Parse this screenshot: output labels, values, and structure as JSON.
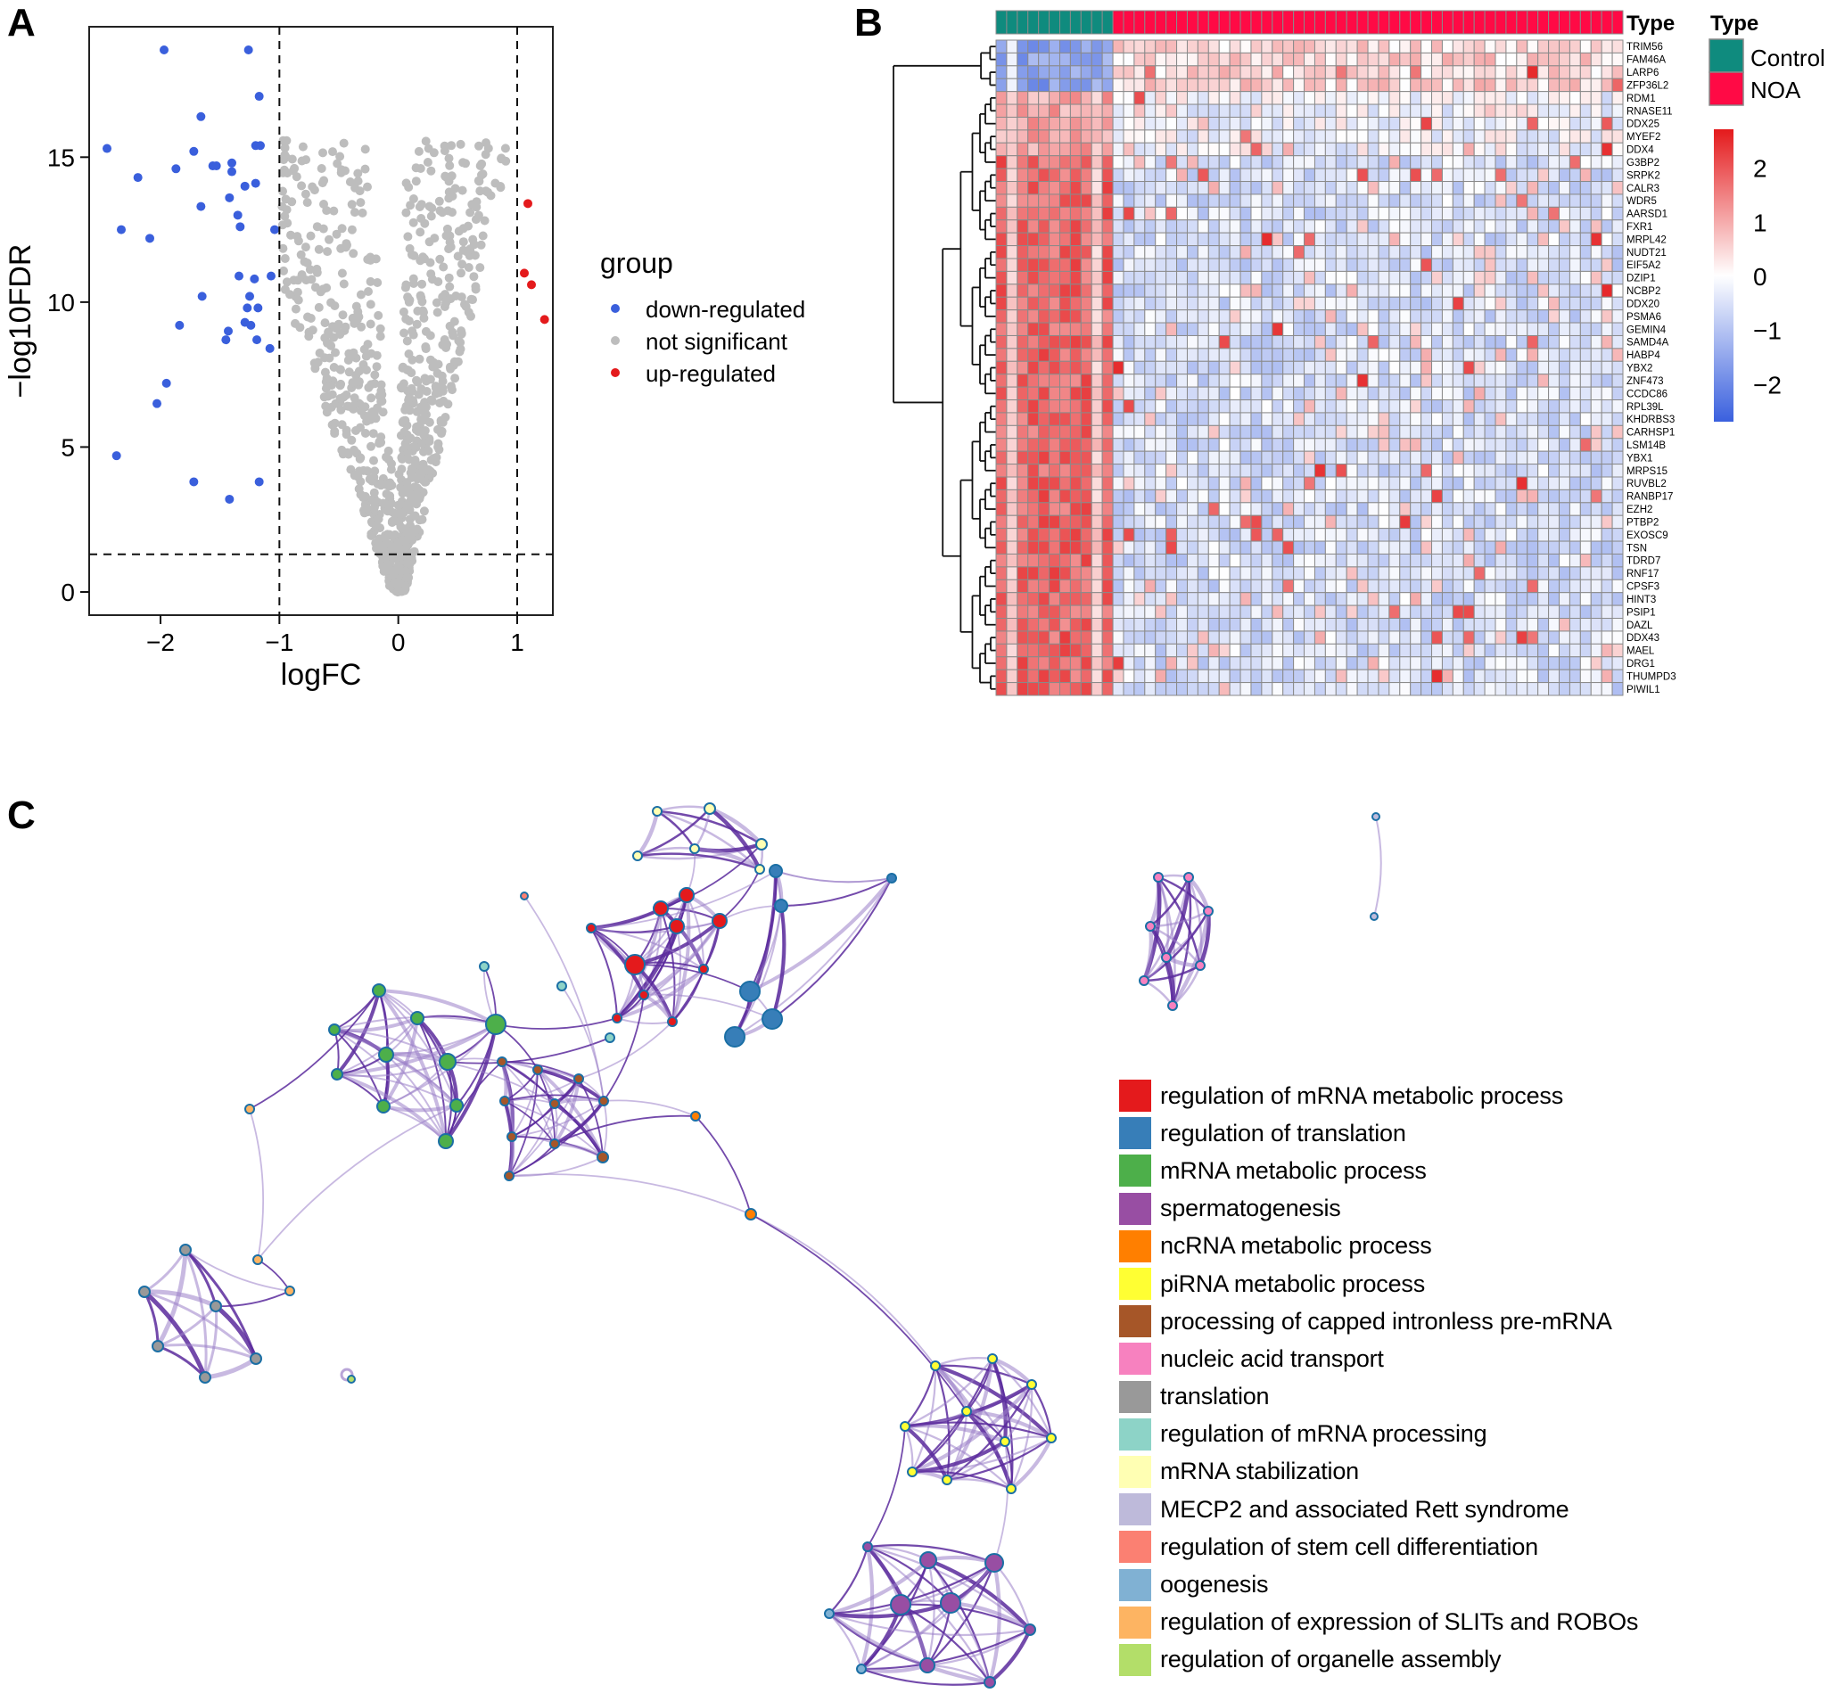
{
  "panels": {
    "a_label": "A",
    "b_label": "B",
    "c_label": "C"
  },
  "chart_data": [
    {
      "id": "volcano",
      "type": "scatter",
      "title": "",
      "xlabel": "logFC",
      "ylabel": "−log10FDR",
      "xlim": [
        -2.6,
        1.3
      ],
      "ylim": [
        -0.8,
        19.5
      ],
      "xticks": [
        -2,
        -1,
        0,
        1
      ],
      "xtick_labels": [
        "−2",
        "−1",
        "0",
        "1"
      ],
      "yticks": [
        0,
        5,
        10,
        15
      ],
      "ytick_labels": [
        "0",
        "5",
        "10",
        "15"
      ],
      "thresholds": {
        "logFC": [
          -1,
          1
        ],
        "neg_log10_FDR": 1.3
      },
      "grid": false,
      "legend": {
        "title": "group",
        "position": "right",
        "entries": [
          {
            "label": "down-regulated",
            "color": "#3A5FDC"
          },
          {
            "label": "not significant",
            "color": "#BDBDBD"
          },
          {
            "label": "up-regulated",
            "color": "#E41A1C"
          }
        ]
      },
      "series": [
        {
          "name": "down-regulated",
          "color": "#3A5FDC",
          "points": [
            [
              -1.97,
              18.7
            ],
            [
              -1.26,
              18.7
            ],
            [
              -1.17,
              17.1
            ],
            [
              -1.66,
              16.4
            ],
            [
              -2.45,
              15.3
            ],
            [
              -1.72,
              15.2
            ],
            [
              -1.2,
              15.4
            ],
            [
              -1.16,
              15.4
            ],
            [
              -1.56,
              14.7
            ],
            [
              -1.53,
              14.7
            ],
            [
              -1.4,
              14.8
            ],
            [
              -1.4,
              14.5
            ],
            [
              -1.87,
              14.6
            ],
            [
              -2.19,
              14.3
            ],
            [
              -1.29,
              14.0
            ],
            [
              -1.2,
              14.1
            ],
            [
              -1.42,
              13.6
            ],
            [
              -1.66,
              13.3
            ],
            [
              -1.35,
              13.0
            ],
            [
              -2.33,
              12.5
            ],
            [
              -2.09,
              12.2
            ],
            [
              -1.33,
              12.6
            ],
            [
              -1.04,
              12.5
            ],
            [
              -1.34,
              10.9
            ],
            [
              -1.21,
              10.8
            ],
            [
              -1.07,
              10.9
            ],
            [
              -1.65,
              10.2
            ],
            [
              -1.25,
              10.2
            ],
            [
              -1.27,
              9.8
            ],
            [
              -1.18,
              9.8
            ],
            [
              -1.84,
              9.2
            ],
            [
              -1.43,
              9.0
            ],
            [
              -1.29,
              9.3
            ],
            [
              -1.24,
              9.2
            ],
            [
              -1.45,
              8.7
            ],
            [
              -1.19,
              8.7
            ],
            [
              -1.08,
              8.4
            ],
            [
              -1.95,
              7.2
            ],
            [
              -2.03,
              6.5
            ],
            [
              -2.37,
              4.7
            ],
            [
              -1.72,
              3.8
            ],
            [
              -1.17,
              3.8
            ],
            [
              -1.42,
              3.2
            ]
          ]
        },
        {
          "name": "up-regulated",
          "color": "#E41A1C",
          "points": [
            [
              1.09,
              13.4
            ],
            [
              1.06,
              11.0
            ],
            [
              1.12,
              10.6
            ],
            [
              1.23,
              9.4
            ]
          ]
        },
        {
          "name": "not significant",
          "color": "#BDBDBD",
          "description": "V-shaped cloud of roughly 900 genes between logFC −1 and 1, minimum near (0,0), max −log10FDR ≈ 15.6"
        }
      ]
    },
    {
      "id": "heatmap",
      "type": "heatmap",
      "title": "",
      "column_annotation": {
        "title": "Type",
        "groups": [
          {
            "name": "Control",
            "color": "#0F8B7E",
            "count": 11
          },
          {
            "name": "NOA",
            "color": "#FF0A45",
            "count": 48
          }
        ]
      },
      "legend_title": "Type",
      "color_scale": {
        "min": -2.7,
        "max": 2.7,
        "ticks": [
          2,
          1,
          0,
          -1,
          -2
        ],
        "tick_labels": [
          "2",
          "1",
          "0",
          "−1",
          "−2"
        ],
        "low_color": "#3A60DE",
        "mid_color": "#FFFFFF",
        "high_color": "#E41A1C"
      },
      "rows": [
        "TRIM56",
        "FAM46A",
        "LARP6",
        "ZFP36L2",
        "RDM1",
        "RNASE11",
        "DDX25",
        "MYEF2",
        "DDX4",
        "G3BP2",
        "SRPK2",
        "CALR3",
        "WDR5",
        "AARSD1",
        "FXR1",
        "MRPL42",
        "NUDT21",
        "EIF5A2",
        "DZIP1",
        "NCBP2",
        "DDX20",
        "PSMA6",
        "GEMIN4",
        "SAMD4A",
        "HABP4",
        "YBX2",
        "ZNF473",
        "CCDC86",
        "RPL39L",
        "KHDRBS3",
        "CARHSP1",
        "LSM14B",
        "YBX1",
        "MRPS15",
        "RUVBL2",
        "RANBP17",
        "EZH2",
        "PTBP2",
        "EXOSC9",
        "TSN",
        "TDRD7",
        "RNF17",
        "CPSF3",
        "HINT3",
        "PSIP1",
        "DAZL",
        "DDX43",
        "MAEL",
        "DRG1",
        "THUMPD3",
        "PIWIL1"
      ],
      "row_groups": [
        {
          "rows": "TRIM56–ZFP36L2",
          "control_mean": -1.6,
          "noa_mean": 0.5
        },
        {
          "rows": "RDM1–DDX4",
          "control_mean": 1.0,
          "noa_mean": -0.2
        },
        {
          "rows": "G3BP2–PIWIL1",
          "control_mean": 1.8,
          "noa_mean": -0.5
        }
      ]
    },
    {
      "id": "network",
      "type": "network",
      "title": "",
      "legend": {
        "position": "right",
        "entries": [
          {
            "label": "regulation of mRNA metabolic process",
            "color": "#E41A1C"
          },
          {
            "label": "regulation of translation",
            "color": "#377EB8"
          },
          {
            "label": "mRNA metabolic process",
            "color": "#4DAF4A"
          },
          {
            "label": "spermatogenesis",
            "color": "#984EA3"
          },
          {
            "label": "ncRNA metabolic process",
            "color": "#FF7F00"
          },
          {
            "label": "piRNA metabolic process",
            "color": "#FFFF33"
          },
          {
            "label": "processing of capped intronless pre-mRNA",
            "color": "#A65628"
          },
          {
            "label": "nucleic acid transport",
            "color": "#F781BF"
          },
          {
            "label": "translation",
            "color": "#999999"
          },
          {
            "label": "regulation of mRNA processing",
            "color": "#8DD3C7"
          },
          {
            "label": "mRNA stabilization",
            "color": "#FFFFB3"
          },
          {
            "label": "MECP2 and associated Rett syndrome",
            "color": "#BEBADA"
          },
          {
            "label": "regulation of stem cell differentiation",
            "color": "#FB8072"
          },
          {
            "label": "oogenesis",
            "color": "#80B1D3"
          },
          {
            "label": "regulation of expression of SLITs and ROBOs",
            "color": "#FDB462"
          },
          {
            "label": "regulation of organelle assembly",
            "color": "#B3DE69"
          }
        ]
      },
      "node_counts": {
        "regulation of mRNA metabolic process": 9,
        "regulation of translation": 6,
        "mRNA metabolic process": 9,
        "spermatogenesis": 7,
        "ncRNA metabolic process": 2,
        "piRNA metabolic process": 10,
        "processing of capped intronless pre-mRNA": 8,
        "nucleic acid transport": 8,
        "translation": 6,
        "regulation of mRNA processing": 3,
        "mRNA stabilization": 6,
        "MECP2 and associated Rett syndrome": 2,
        "regulation of stem cell differentiation": 1,
        "oogenesis": 2,
        "regulation of expression of SLITs and ROBOs": 4,
        "regulation of organelle assembly": 1
      }
    }
  ]
}
